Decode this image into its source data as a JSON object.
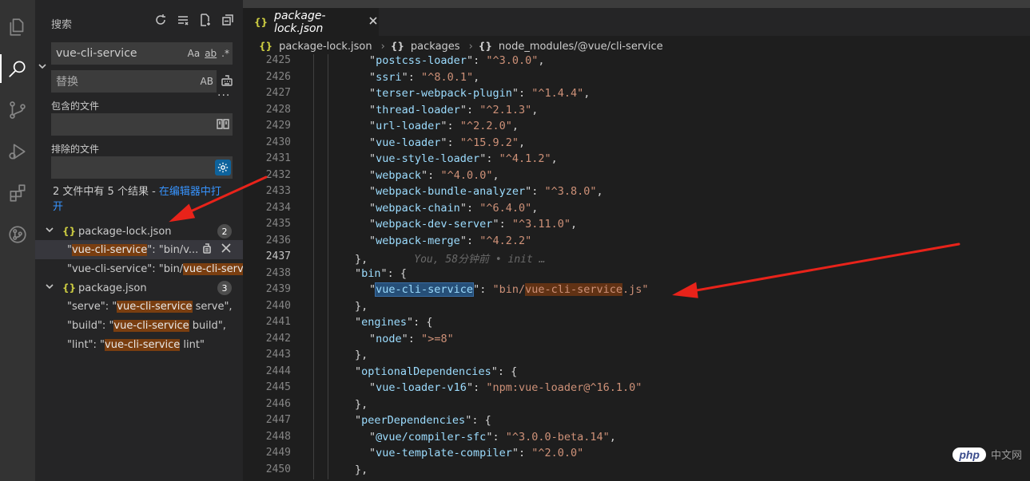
{
  "activity_icons": [
    "explorer-icon",
    "search-icon",
    "source-control-icon",
    "run-debug-icon",
    "extensions-icon",
    "git-graph-icon"
  ],
  "sidebar": {
    "title": "搜索",
    "search_value": "vue-cli-service",
    "search_options": [
      "Aa",
      "ab",
      ".*"
    ],
    "replace_placeholder": "替换",
    "replace_option": "AB",
    "more": "···",
    "include_label": "包含的文件",
    "exclude_label": "排除的文件",
    "summary_prefix": "2 文件中有 5 个结果 - ",
    "summary_link": "在编辑器中打开",
    "files": [
      {
        "icon": "{}",
        "name": "package-lock.json",
        "count": "2",
        "matches": [
          {
            "pre": "\"",
            "hl": "vue-cli-service",
            "post": "\": \"bin/v..."
          },
          {
            "pre": "\"vue-cli-service\": \"bin/",
            "hl": "vue-cli-serv...",
            "post": ""
          }
        ]
      },
      {
        "icon": "{}",
        "name": "package.json",
        "count": "3",
        "matches": [
          {
            "pre": "\"serve\": \"",
            "hl": "vue-cli-service",
            "post": " serve\","
          },
          {
            "pre": "\"build\": \"",
            "hl": "vue-cli-service",
            "post": " build\","
          },
          {
            "pre": "\"lint\": \"",
            "hl": "vue-cli-service",
            "post": " lint\""
          }
        ]
      }
    ]
  },
  "editor": {
    "tab": {
      "icon": "{}",
      "name": "package-lock.json"
    },
    "breadcrumb": [
      {
        "icon": "{}",
        "label": "package-lock.json"
      },
      {
        "icon": "{}",
        "label": "packages"
      },
      {
        "icon": "{}",
        "label": "node_modules/@vue/cli-service"
      }
    ],
    "current_line": "2437",
    "lines": [
      {
        "n": "2425",
        "k": "postcss-loader",
        "v": "^3.0.0",
        "t": ","
      },
      {
        "n": "2426",
        "k": "ssri",
        "v": "^8.0.1",
        "t": ","
      },
      {
        "n": "2427",
        "k": "terser-webpack-plugin",
        "v": "^1.4.4",
        "t": ","
      },
      {
        "n": "2428",
        "k": "thread-loader",
        "v": "^2.1.3",
        "t": ","
      },
      {
        "n": "2429",
        "k": "url-loader",
        "v": "^2.2.0",
        "t": ","
      },
      {
        "n": "2430",
        "k": "vue-loader",
        "v": "^15.9.2",
        "t": ","
      },
      {
        "n": "2431",
        "k": "vue-style-loader",
        "v": "^4.1.2",
        "t": ","
      },
      {
        "n": "2432",
        "k": "webpack",
        "v": "^4.0.0",
        "t": ","
      },
      {
        "n": "2433",
        "k": "webpack-bundle-analyzer",
        "v": "^3.8.0",
        "t": ","
      },
      {
        "n": "2434",
        "k": "webpack-chain",
        "v": "^6.4.0",
        "t": ","
      },
      {
        "n": "2435",
        "k": "webpack-dev-server",
        "v": "^3.11.0",
        "t": ","
      },
      {
        "n": "2436",
        "k": "webpack-merge",
        "v": "^4.2.2",
        "t": ""
      },
      {
        "n": "2437",
        "raw": "},",
        "blame": "You, 58分钟前 • init …"
      },
      {
        "n": "2438",
        "k": "bin",
        "open": true
      },
      {
        "n": "2439",
        "k": "vue-cli-service",
        "v": "bin/vue-cli-service.js",
        "t": "",
        "special": true
      },
      {
        "n": "2440",
        "raw": "},"
      },
      {
        "n": "2441",
        "k": "engines",
        "open": true
      },
      {
        "n": "2442",
        "k": "node",
        "v": ">=8",
        "t": ""
      },
      {
        "n": "2443",
        "raw": "},"
      },
      {
        "n": "2444",
        "k": "optionalDependencies",
        "open": true
      },
      {
        "n": "2445",
        "k": "vue-loader-v16",
        "v": "npm:vue-loader@^16.1.0",
        "t": ""
      },
      {
        "n": "2446",
        "raw": "},"
      },
      {
        "n": "2447",
        "k": "peerDependencies",
        "open": true
      },
      {
        "n": "2448",
        "k": "@vue/compiler-sfc",
        "v": "^3.0.0-beta.14",
        "t": ","
      },
      {
        "n": "2449",
        "k": "vue-template-compiler",
        "v": "^2.0.0",
        "t": ""
      },
      {
        "n": "2450",
        "raw": "},"
      }
    ]
  },
  "watermark": {
    "brand": "php",
    "text": "中文网"
  },
  "colors": {
    "accent": "#0e639c",
    "link": "#3794ff",
    "arrow": "#e8231a",
    "match_highlight": "#7a3e10"
  }
}
